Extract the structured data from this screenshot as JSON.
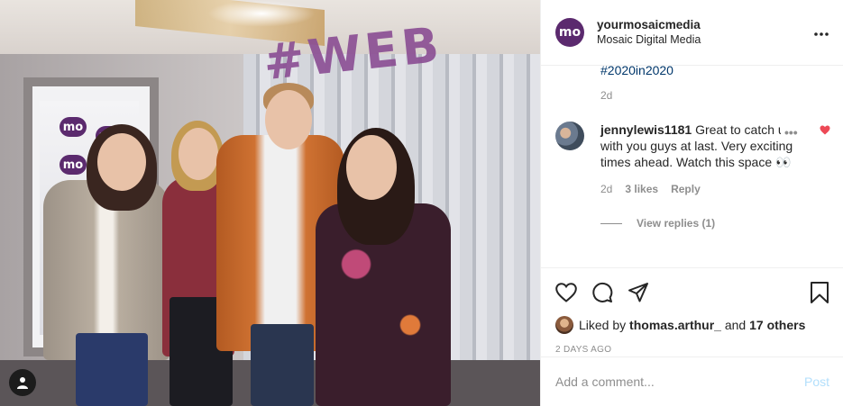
{
  "post": {
    "account": {
      "username": "yourmosaicmedia",
      "subtitle": "Mosaic Digital Media",
      "logo_text": "mo"
    },
    "more_icon": "more-horizontal-icon",
    "caption": {
      "hashtag": "#2020in2020",
      "time": "2d"
    },
    "photo": {
      "sign_text": "#WEB",
      "logo_text": "mo"
    },
    "comments": [
      {
        "username": "jennylewis1181",
        "text": "Great to catch up with you guys at last. Very exciting times ahead. Watch this space 👀",
        "time": "2d",
        "likes": "3 likes",
        "reply": "Reply",
        "liked": true
      }
    ],
    "view_replies": "View replies (1)",
    "actions": {
      "like_icon": "heart-icon",
      "comment_icon": "comment-icon",
      "share_icon": "send-icon",
      "save_icon": "bookmark-icon"
    },
    "likes": {
      "prefix": "Liked by",
      "user": "thomas.arthur_",
      "joiner": "and",
      "others": "17 others"
    },
    "posted_ago": "2 DAYS AGO",
    "add_comment": {
      "placeholder": "Add a comment...",
      "post_label": "Post"
    },
    "colors": {
      "brand": "#5b2a6e",
      "heart": "#ed4956",
      "link": "#00376b",
      "post_disabled": "#b2dffc"
    }
  }
}
